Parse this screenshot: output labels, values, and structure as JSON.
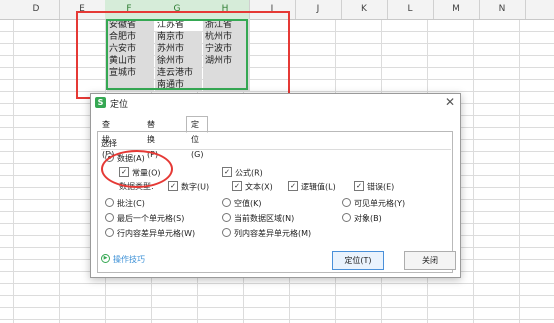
{
  "spreadsheet": {
    "columns": [
      "D",
      "E",
      "F",
      "G",
      "H",
      "I",
      "J",
      "K",
      "L",
      "M",
      "N"
    ],
    "selected_columns": [
      "F",
      "G",
      "H"
    ],
    "cells": {
      "F": [
        "安徽省",
        "合肥市",
        "六安市",
        "黄山市",
        "宣城市"
      ],
      "G": [
        "江苏省",
        "南京市",
        "苏州市",
        "徐州市",
        "连云港市",
        "南通市"
      ],
      "H": [
        "浙江省",
        "杭州市",
        "宁波市",
        "湖州市"
      ]
    }
  },
  "dialog": {
    "title": "定位",
    "close_icon": "✕",
    "tabs": [
      "查找(D)",
      "替换(P)",
      "定位(G)"
    ],
    "active_tab": "定位(G)",
    "section_label": "选择",
    "options": {
      "data": "数据(A)",
      "constant": "常量(O)",
      "formula": "公式(R)",
      "data_type_label": "数据类型:",
      "number": "数字(U)",
      "text": "文本(X)",
      "logical": "逻辑值(L)",
      "error": "错误(E)",
      "comment": "批注(C)",
      "blank": "空值(K)",
      "visible": "可见单元格(Y)",
      "last_cell": "最后一个单元格(S)",
      "current_region": "当前数据区域(N)",
      "object": "对象(B)",
      "row_diff": "行内容差异单元格(W)",
      "col_diff": "列内容差异单元格(M)"
    },
    "selected_radio": "data",
    "checked": [
      "constant",
      "formula",
      "number",
      "text",
      "logical",
      "error"
    ],
    "tips_label": "操作技巧",
    "locate_button": "定位(T)",
    "close_button": "关闭",
    "accent_color": "#36a853",
    "highlight_color": "#e53935"
  }
}
